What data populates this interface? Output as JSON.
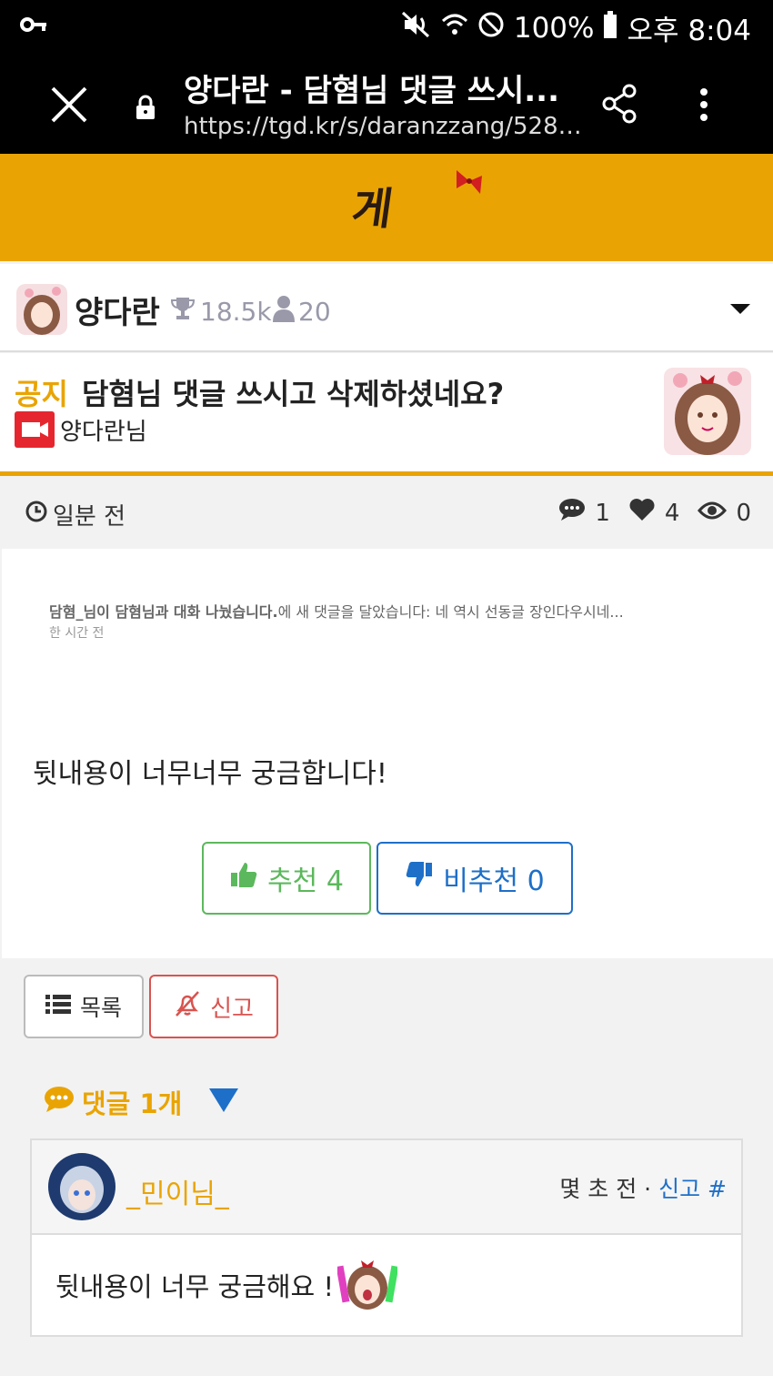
{
  "status_bar": {
    "battery": "100%",
    "time": "오후 8:04"
  },
  "browser": {
    "page_title": "양다란 - 담혐님 댓글 쓰시...",
    "url": "https://tgd.kr/s/daranzzang/52851..."
  },
  "banner": {
    "text": "게"
  },
  "board": {
    "name": "양다란",
    "trophy_count": "18.5k",
    "member_count": "20"
  },
  "post": {
    "notice_label": "공지",
    "title": "담혐님 댓글 쓰시고 삭제하셨네요?",
    "author": "양다란님",
    "time": "일분 전",
    "comments": "1",
    "likes": "4",
    "views": "0",
    "screenshot_line1_bold": "담혐_님이 담혐님과 대화 나눴습니다.",
    "screenshot_line1_rest": "에 새 댓글을 달았습니다: 네 역시 선동글 장인다우시네...",
    "screenshot_line2": "한 시간 전",
    "body": "뒷내용이 너무너무 궁금합니다!",
    "upvote_label": "추천 4",
    "downvote_label": "비추천 0"
  },
  "actions": {
    "list_label": "목록",
    "report_label": "신고"
  },
  "comments": {
    "header": "댓글 1개",
    "items": [
      {
        "user": "_민이님_",
        "time": "몇 초 전",
        "report": "신고",
        "hash": "#",
        "text": "뒷내용이 너무 궁금해요 !"
      }
    ]
  },
  "colors": {
    "accent": "#e9a404",
    "upvote": "#5cb85c",
    "downvote": "#1e6fc8",
    "report": "#d9534f"
  }
}
